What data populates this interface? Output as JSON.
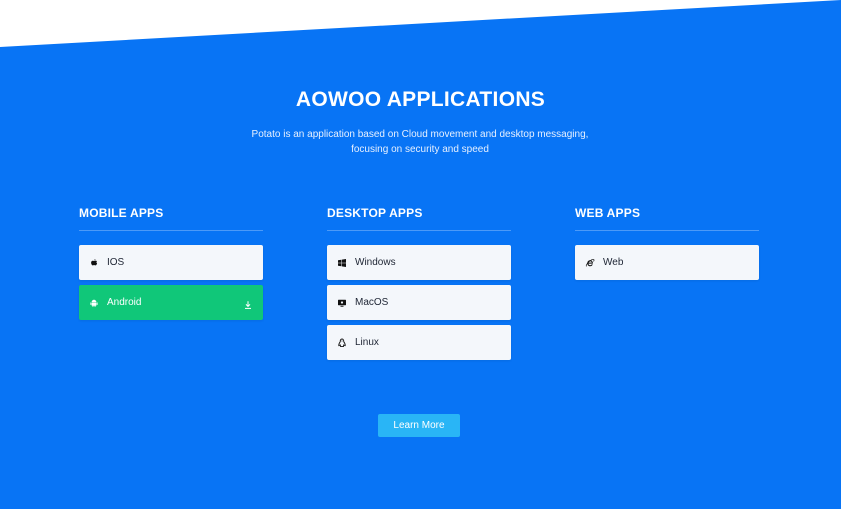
{
  "header": {
    "title": "AOWOO APPLICATIONS",
    "subtitle": "Potato is an application based on Cloud movement and desktop messaging, focusing on security and speed"
  },
  "columns": [
    {
      "heading": "MOBILE APPS",
      "items": [
        {
          "label": "IOS",
          "icon": "apple-icon",
          "active": false
        },
        {
          "label": "Android",
          "icon": "android-icon",
          "active": true,
          "download_icon": "download-icon"
        }
      ]
    },
    {
      "heading": "DESKTOP APPS",
      "items": [
        {
          "label": "Windows",
          "icon": "windows-icon",
          "active": false
        },
        {
          "label": "MacOS",
          "icon": "monitor-icon",
          "active": false
        },
        {
          "label": "Linux",
          "icon": "linux-icon",
          "active": false
        }
      ]
    },
    {
      "heading": "WEB APPS",
      "items": [
        {
          "label": "Web",
          "icon": "internet-explorer-icon",
          "active": false
        }
      ]
    }
  ],
  "cta": {
    "label": "Learn More"
  },
  "colors": {
    "background": "#0874f5",
    "card": "#f4f7fb",
    "active_card": "#10c779",
    "button": "#29b5f6",
    "wedge": "#ffffff"
  }
}
